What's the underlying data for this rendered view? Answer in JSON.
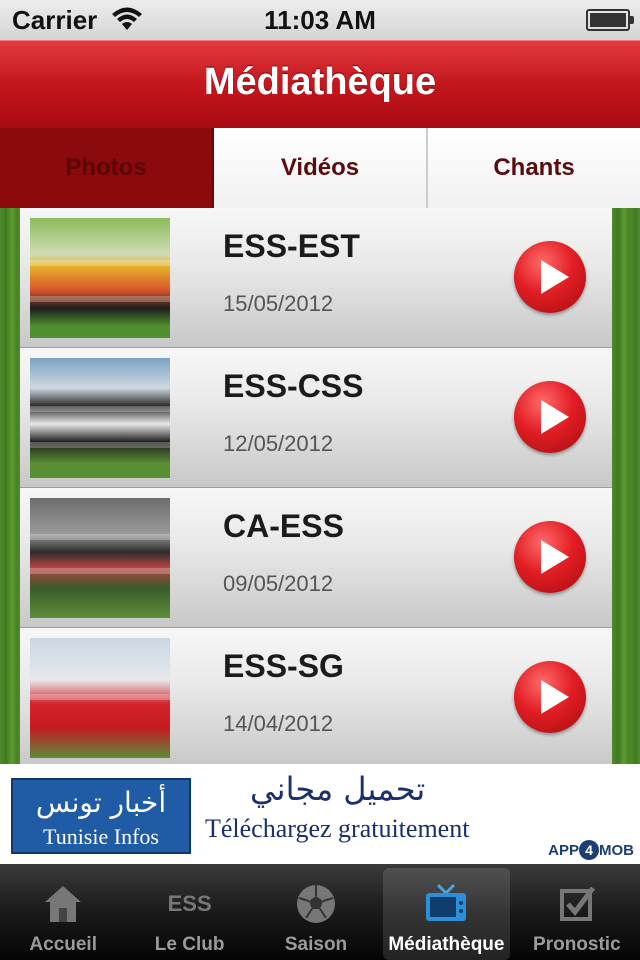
{
  "status_bar": {
    "carrier": "Carrier",
    "time": "11:03 AM"
  },
  "nav_bar": {
    "title": "Médiathèque"
  },
  "segments": [
    {
      "label": "Photos",
      "selected": true
    },
    {
      "label": "Vidéos",
      "selected": false
    },
    {
      "label": "Chants",
      "selected": false
    }
  ],
  "videos": [
    {
      "title": "ESS-EST",
      "date": "15/05/2012",
      "thumbnail": "team-photo"
    },
    {
      "title": "ESS-CSS",
      "date": "12/05/2012",
      "thumbnail": "team-photo"
    },
    {
      "title": "CA-ESS",
      "date": "09/05/2012",
      "thumbnail": "stadium-photo"
    },
    {
      "title": "ESS-SG",
      "date": "14/04/2012",
      "thumbnail": "celebration-photo"
    }
  ],
  "ad": {
    "logo_arabic": "أخبار تونس",
    "logo_text": "Tunisie Infos",
    "arabic_text": "تحميل مجاني",
    "french_text": "Téléchargez gratuitement",
    "brand_prefix": "APP",
    "brand_number": "4",
    "brand_suffix": "MOB"
  },
  "tab_bar": [
    {
      "label": "Accueil",
      "icon": "home-icon",
      "selected": false
    },
    {
      "label": "Le Club",
      "icon": "ess-logo-icon",
      "icon_text": "ESS",
      "selected": false
    },
    {
      "label": "Saison",
      "icon": "soccer-ball-icon",
      "selected": false
    },
    {
      "label": "Médiathèque",
      "icon": "tv-icon",
      "selected": true
    },
    {
      "label": "Pronostic",
      "icon": "checkbox-icon",
      "selected": false
    }
  ],
  "colors": {
    "primary_red": "#c4161d",
    "dark_red": "#8b0a0d",
    "tab_text": "#5c0b0e"
  }
}
